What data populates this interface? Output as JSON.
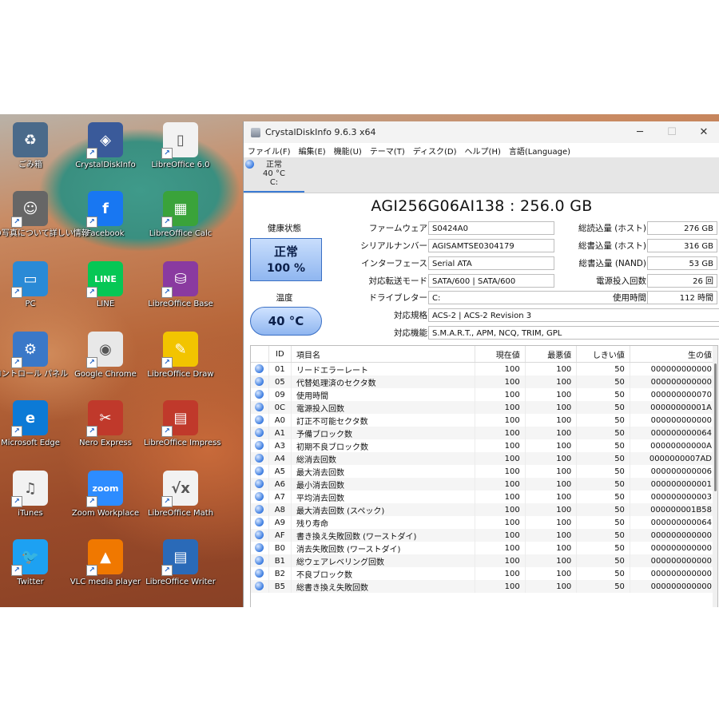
{
  "desktop": {
    "icons": [
      {
        "label": "ごみ箱",
        "icon": "recycle-bin-icon"
      },
      {
        "label": "CrystalDiskInfo",
        "icon": "crystaldiskinfo-icon"
      },
      {
        "label": "LibreOffice 6.0",
        "icon": "libreoffice-icon"
      },
      {
        "label": "の写真について詳しい情報",
        "icon": "info-icon"
      },
      {
        "label": "Facebook",
        "icon": "facebook-icon"
      },
      {
        "label": "LibreOffice Calc",
        "icon": "libreoffice-calc-icon"
      },
      {
        "label": "PC",
        "icon": "monitor-icon"
      },
      {
        "label": "LINE",
        "icon": "line-icon"
      },
      {
        "label": "LibreOffice Base",
        "icon": "libreoffice-base-icon"
      },
      {
        "label": "コントロール パネル",
        "icon": "control-panel-icon"
      },
      {
        "label": "Google Chrome",
        "icon": "chrome-icon"
      },
      {
        "label": "LibreOffice Draw",
        "icon": "libreoffice-draw-icon"
      },
      {
        "label": "Microsoft Edge",
        "icon": "edge-icon"
      },
      {
        "label": "Nero Express",
        "icon": "nero-icon"
      },
      {
        "label": "LibreOffice Impress",
        "icon": "libreoffice-impress-icon"
      },
      {
        "label": "iTunes",
        "icon": "itunes-icon"
      },
      {
        "label": "Zoom Workplace",
        "icon": "zoom-icon"
      },
      {
        "label": "LibreOffice Math",
        "icon": "libreoffice-math-icon"
      },
      {
        "label": "Twitter",
        "icon": "twitter-icon"
      },
      {
        "label": "VLC media player",
        "icon": "vlc-icon"
      },
      {
        "label": "LibreOffice Writer",
        "icon": "libreoffice-writer-icon"
      }
    ],
    "icon_glyphs": [
      "♻",
      "◈",
      "▯",
      "☺",
      "f",
      "▦",
      "▭",
      "LINE",
      "⛁",
      "⚙",
      "◉",
      "✎",
      "e",
      "✂",
      "▤",
      "♫",
      "zoom",
      "√x",
      "🐦",
      "▲",
      "▤"
    ],
    "icon_colors": [
      "#4a6a8a",
      "#3a5a9a",
      "#f2f2f2",
      "#666666",
      "#1877f2",
      "#3aa33a",
      "#2a8ad6",
      "#06c755",
      "#8a3aa0",
      "#3a78c8",
      "#e8e8e8",
      "#f2c400",
      "#0c7ad6",
      "#c0392b",
      "#c0392b",
      "#f2f2f2",
      "#2d8cff",
      "#f2f2f2",
      "#1da1f2",
      "#f07800",
      "#2a6ab8"
    ]
  },
  "window": {
    "title": "CrystalDiskInfo 9.6.3 x64",
    "minimize": "─",
    "maximize": "☐",
    "close": "✕",
    "menu": [
      "ファイル(F)",
      "編集(E)",
      "機能(U)",
      "テーマ(T)",
      "ディスク(D)",
      "ヘルプ(H)",
      "言語(Language)"
    ],
    "drive_tab": {
      "status": "正常",
      "temp": "40 °C",
      "letter": "C:"
    }
  },
  "drive": {
    "name": "AGI256G06AI138 : 256.0 GB",
    "health_label": "健康状態",
    "health_status": "正常",
    "health_percent": "100 %",
    "temp_label": "温度",
    "temp_value": "40 °C",
    "info": [
      {
        "label": "ファームウェア",
        "value": "S0424A0"
      },
      {
        "label": "シリアルナンバー",
        "value": "AGISAMTSE0304179"
      },
      {
        "label": "インターフェース",
        "value": "Serial ATA"
      },
      {
        "label": "対応転送モード",
        "value": "SATA/600 | SATA/600"
      },
      {
        "label": "ドライブレター",
        "value": "C:"
      }
    ],
    "standard": {
      "label": "対応規格",
      "value": "ACS-2 | ACS-2 Revision 3"
    },
    "features": {
      "label": "対応機能",
      "value": "S.M.A.R.T., APM, NCQ, TRIM, GPL"
    },
    "stats": [
      {
        "label": "総読込量 (ホスト)",
        "value": "276 GB"
      },
      {
        "label": "総書込量 (ホスト)",
        "value": "316 GB"
      },
      {
        "label": "総書込量 (NAND)",
        "value": "53 GB"
      },
      {
        "label": "電源投入回数",
        "value": "26 回"
      },
      {
        "label": "使用時間",
        "value": "112 時間"
      }
    ]
  },
  "smart": {
    "headers": [
      "ID",
      "項目名",
      "現在値",
      "最悪値",
      "しきい値",
      "生の値"
    ],
    "rows": [
      [
        "01",
        "リードエラーレート",
        "100",
        "100",
        "50",
        "000000000000"
      ],
      [
        "05",
        "代替処理済のセクタ数",
        "100",
        "100",
        "50",
        "000000000000"
      ],
      [
        "09",
        "使用時間",
        "100",
        "100",
        "50",
        "000000000070"
      ],
      [
        "0C",
        "電源投入回数",
        "100",
        "100",
        "50",
        "00000000001A"
      ],
      [
        "A0",
        "訂正不可能セクタ数",
        "100",
        "100",
        "50",
        "000000000000"
      ],
      [
        "A1",
        "予備ブロック数",
        "100",
        "100",
        "50",
        "000000000064"
      ],
      [
        "A3",
        "初期不良ブロック数",
        "100",
        "100",
        "50",
        "00000000000A"
      ],
      [
        "A4",
        "総消去回数",
        "100",
        "100",
        "50",
        "0000000007AD"
      ],
      [
        "A5",
        "最大消去回数",
        "100",
        "100",
        "50",
        "000000000006"
      ],
      [
        "A6",
        "最小消去回数",
        "100",
        "100",
        "50",
        "000000000001"
      ],
      [
        "A7",
        "平均消去回数",
        "100",
        "100",
        "50",
        "000000000003"
      ],
      [
        "A8",
        "最大消去回数 (スペック)",
        "100",
        "100",
        "50",
        "000000001B58"
      ],
      [
        "A9",
        "残り寿命",
        "100",
        "100",
        "50",
        "000000000064"
      ],
      [
        "AF",
        "書き換え失敗回数 (ワーストダイ)",
        "100",
        "100",
        "50",
        "000000000000"
      ],
      [
        "B0",
        "消去失敗回数 (ワーストダイ)",
        "100",
        "100",
        "50",
        "000000000000"
      ],
      [
        "B1",
        "総ウェアレベリング回数",
        "100",
        "100",
        "50",
        "000000000000"
      ],
      [
        "B2",
        "不良ブロック数",
        "100",
        "100",
        "50",
        "000000000000"
      ],
      [
        "B5",
        "総書き換え失敗回数",
        "100",
        "100",
        "50",
        "000000000000"
      ]
    ]
  }
}
